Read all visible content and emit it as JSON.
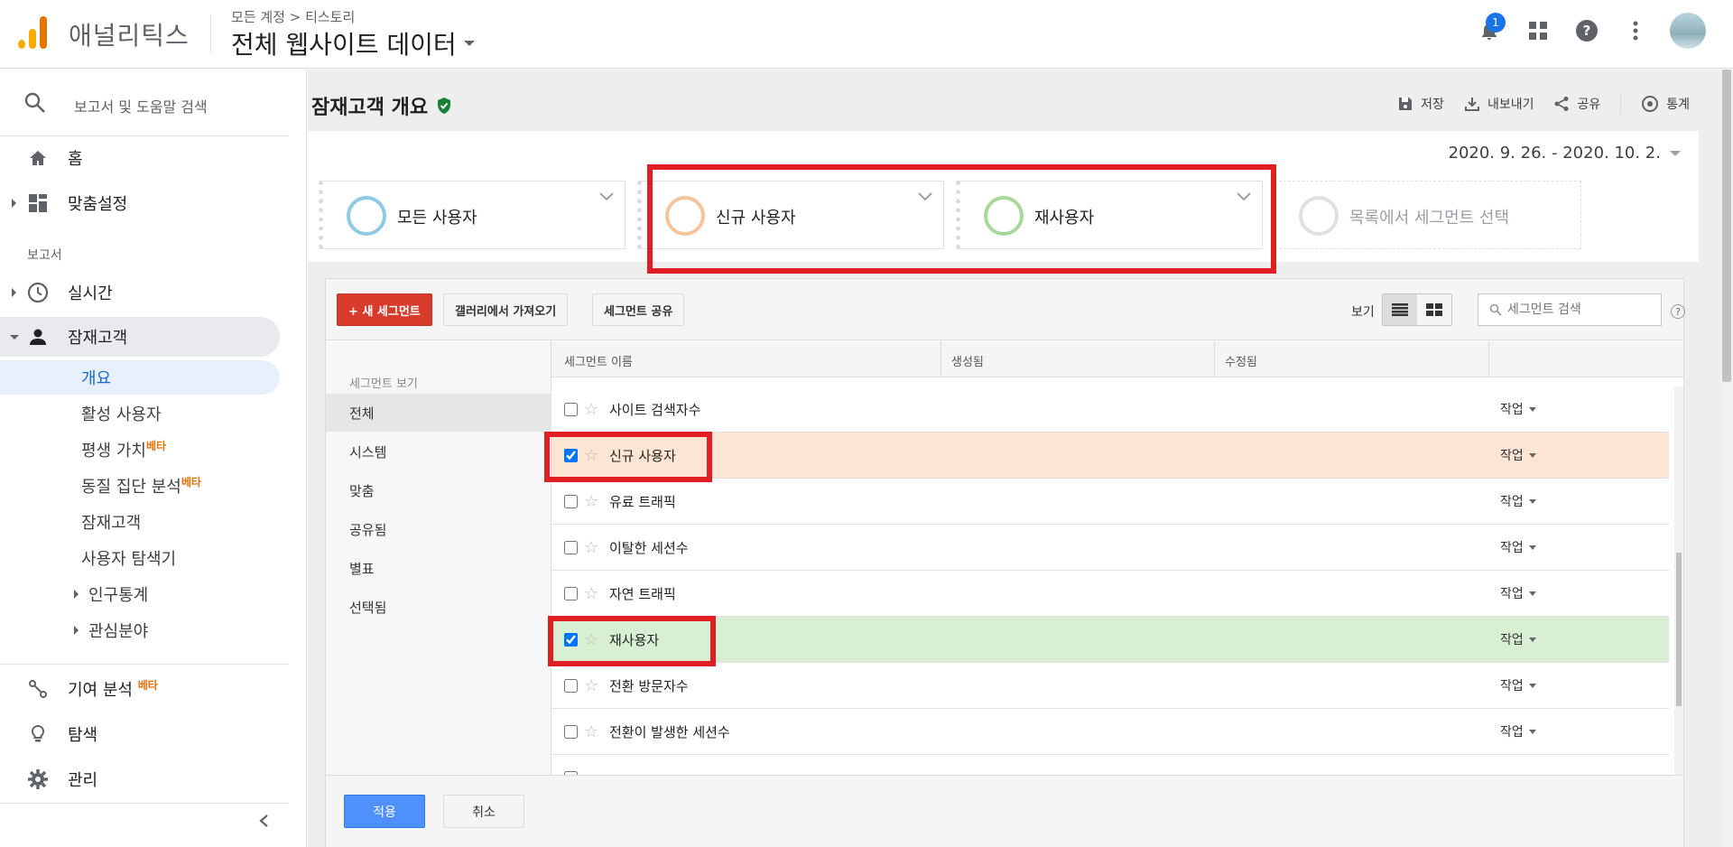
{
  "header": {
    "app_name": "애널리틱스",
    "breadcrumb": "모든 계정 > 티스토리",
    "property": "전체 웹사이트 데이터",
    "notification_count": "1"
  },
  "sidebar": {
    "search_label": "보고서 및 도움말 검색",
    "home": "홈",
    "customization": "맞춤설정",
    "reports_section": "보고서",
    "realtime": "실시간",
    "audience": "잠재고객",
    "audience_items": [
      {
        "label": "개요"
      },
      {
        "label": "활성 사용자"
      },
      {
        "label": "평생 가치",
        "beta": "베타"
      },
      {
        "label": "동질 집단 분석",
        "beta": "베타"
      },
      {
        "label": "잠재고객"
      },
      {
        "label": "사용자 탐색기"
      },
      {
        "label": "인구통계"
      },
      {
        "label": "관심분야"
      }
    ],
    "attribution": "기여 분석",
    "attribution_beta": "베타",
    "discover": "탐색",
    "admin": "관리"
  },
  "page": {
    "title": "잠재고객 개요",
    "actions": {
      "save": "저장",
      "export": "내보내기",
      "share": "공유",
      "insights": "통계"
    },
    "date_range": "2020. 9. 26. - 2020. 10. 2."
  },
  "segments": [
    {
      "label": "모든 사용자",
      "color": "#8ecae6"
    },
    {
      "label": "신규 사용자",
      "color": "#f6c39a"
    },
    {
      "label": "재사용자",
      "color": "#a8d89a"
    },
    {
      "label": "목록에서 세그먼트 선택",
      "color": "#e0e0e0"
    }
  ],
  "picker": {
    "new_segment": "+ 새 세그먼트",
    "import_gallery": "갤러리에서 가져오기",
    "share_segment": "세그먼트 공유",
    "view_label": "보기",
    "search_placeholder": "세그먼트 검색",
    "help": "?",
    "left_heading": "세그먼트 보기",
    "categories": [
      "전체",
      "시스템",
      "맞춤",
      "공유됨",
      "별표",
      "선택됨"
    ],
    "columns": {
      "name": "세그먼트 이름",
      "created": "생성됨",
      "modified": "수정됨"
    },
    "action_label": "작업",
    "rows": [
      {
        "name": "사이트 검색자수",
        "checked": false
      },
      {
        "name": "신규 사용자",
        "checked": true
      },
      {
        "name": "유료 트래픽",
        "checked": false
      },
      {
        "name": "이탈한 세션수",
        "checked": false
      },
      {
        "name": "자연 트래픽",
        "checked": false
      },
      {
        "name": "재사용자",
        "checked": true
      },
      {
        "name": "전환 방문자수",
        "checked": false
      },
      {
        "name": "전환이 발생한 세션수",
        "checked": false
      }
    ],
    "apply": "적용",
    "cancel": "취소"
  },
  "colors": {
    "highlight_red": "#e01e23",
    "new_users_row": "#fce5d3",
    "returning_row": "#d9efd4",
    "apply_blue": "#4d90fe",
    "new_segment_red": "#d73b2b"
  }
}
